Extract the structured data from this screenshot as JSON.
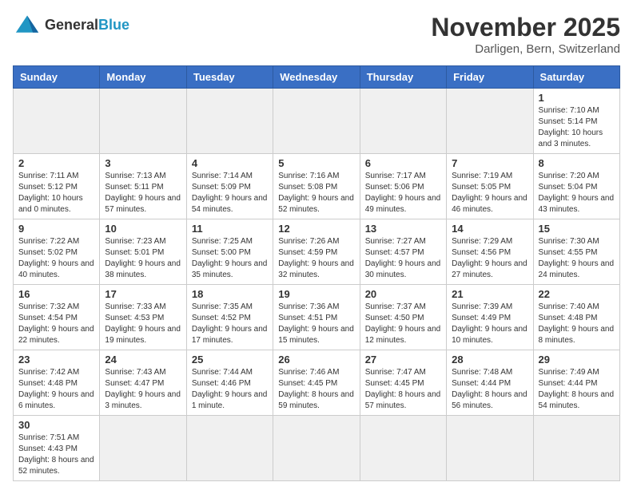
{
  "header": {
    "logo_general": "General",
    "logo_blue": "Blue",
    "month_year": "November 2025",
    "location": "Darligen, Bern, Switzerland"
  },
  "days_of_week": [
    "Sunday",
    "Monday",
    "Tuesday",
    "Wednesday",
    "Thursday",
    "Friday",
    "Saturday"
  ],
  "weeks": [
    [
      {
        "day": "",
        "info": "",
        "empty": true
      },
      {
        "day": "",
        "info": "",
        "empty": true
      },
      {
        "day": "",
        "info": "",
        "empty": true
      },
      {
        "day": "",
        "info": "",
        "empty": true
      },
      {
        "day": "",
        "info": "",
        "empty": true
      },
      {
        "day": "",
        "info": "",
        "empty": true
      },
      {
        "day": "1",
        "info": "Sunrise: 7:10 AM\nSunset: 5:14 PM\nDaylight: 10 hours and 3 minutes."
      }
    ],
    [
      {
        "day": "2",
        "info": "Sunrise: 7:11 AM\nSunset: 5:12 PM\nDaylight: 10 hours and 0 minutes."
      },
      {
        "day": "3",
        "info": "Sunrise: 7:13 AM\nSunset: 5:11 PM\nDaylight: 9 hours and 57 minutes."
      },
      {
        "day": "4",
        "info": "Sunrise: 7:14 AM\nSunset: 5:09 PM\nDaylight: 9 hours and 54 minutes."
      },
      {
        "day": "5",
        "info": "Sunrise: 7:16 AM\nSunset: 5:08 PM\nDaylight: 9 hours and 52 minutes."
      },
      {
        "day": "6",
        "info": "Sunrise: 7:17 AM\nSunset: 5:06 PM\nDaylight: 9 hours and 49 minutes."
      },
      {
        "day": "7",
        "info": "Sunrise: 7:19 AM\nSunset: 5:05 PM\nDaylight: 9 hours and 46 minutes."
      },
      {
        "day": "8",
        "info": "Sunrise: 7:20 AM\nSunset: 5:04 PM\nDaylight: 9 hours and 43 minutes."
      }
    ],
    [
      {
        "day": "9",
        "info": "Sunrise: 7:22 AM\nSunset: 5:02 PM\nDaylight: 9 hours and 40 minutes."
      },
      {
        "day": "10",
        "info": "Sunrise: 7:23 AM\nSunset: 5:01 PM\nDaylight: 9 hours and 38 minutes."
      },
      {
        "day": "11",
        "info": "Sunrise: 7:25 AM\nSunset: 5:00 PM\nDaylight: 9 hours and 35 minutes."
      },
      {
        "day": "12",
        "info": "Sunrise: 7:26 AM\nSunset: 4:59 PM\nDaylight: 9 hours and 32 minutes."
      },
      {
        "day": "13",
        "info": "Sunrise: 7:27 AM\nSunset: 4:57 PM\nDaylight: 9 hours and 30 minutes."
      },
      {
        "day": "14",
        "info": "Sunrise: 7:29 AM\nSunset: 4:56 PM\nDaylight: 9 hours and 27 minutes."
      },
      {
        "day": "15",
        "info": "Sunrise: 7:30 AM\nSunset: 4:55 PM\nDaylight: 9 hours and 24 minutes."
      }
    ],
    [
      {
        "day": "16",
        "info": "Sunrise: 7:32 AM\nSunset: 4:54 PM\nDaylight: 9 hours and 22 minutes."
      },
      {
        "day": "17",
        "info": "Sunrise: 7:33 AM\nSunset: 4:53 PM\nDaylight: 9 hours and 19 minutes."
      },
      {
        "day": "18",
        "info": "Sunrise: 7:35 AM\nSunset: 4:52 PM\nDaylight: 9 hours and 17 minutes."
      },
      {
        "day": "19",
        "info": "Sunrise: 7:36 AM\nSunset: 4:51 PM\nDaylight: 9 hours and 15 minutes."
      },
      {
        "day": "20",
        "info": "Sunrise: 7:37 AM\nSunset: 4:50 PM\nDaylight: 9 hours and 12 minutes."
      },
      {
        "day": "21",
        "info": "Sunrise: 7:39 AM\nSunset: 4:49 PM\nDaylight: 9 hours and 10 minutes."
      },
      {
        "day": "22",
        "info": "Sunrise: 7:40 AM\nSunset: 4:48 PM\nDaylight: 9 hours and 8 minutes."
      }
    ],
    [
      {
        "day": "23",
        "info": "Sunrise: 7:42 AM\nSunset: 4:48 PM\nDaylight: 9 hours and 6 minutes."
      },
      {
        "day": "24",
        "info": "Sunrise: 7:43 AM\nSunset: 4:47 PM\nDaylight: 9 hours and 3 minutes."
      },
      {
        "day": "25",
        "info": "Sunrise: 7:44 AM\nSunset: 4:46 PM\nDaylight: 9 hours and 1 minute."
      },
      {
        "day": "26",
        "info": "Sunrise: 7:46 AM\nSunset: 4:45 PM\nDaylight: 8 hours and 59 minutes."
      },
      {
        "day": "27",
        "info": "Sunrise: 7:47 AM\nSunset: 4:45 PM\nDaylight: 8 hours and 57 minutes."
      },
      {
        "day": "28",
        "info": "Sunrise: 7:48 AM\nSunset: 4:44 PM\nDaylight: 8 hours and 56 minutes."
      },
      {
        "day": "29",
        "info": "Sunrise: 7:49 AM\nSunset: 4:44 PM\nDaylight: 8 hours and 54 minutes."
      }
    ],
    [
      {
        "day": "30",
        "info": "Sunrise: 7:51 AM\nSunset: 4:43 PM\nDaylight: 8 hours and 52 minutes."
      },
      {
        "day": "",
        "info": "",
        "empty": true
      },
      {
        "day": "",
        "info": "",
        "empty": true
      },
      {
        "day": "",
        "info": "",
        "empty": true
      },
      {
        "day": "",
        "info": "",
        "empty": true
      },
      {
        "day": "",
        "info": "",
        "empty": true
      },
      {
        "day": "",
        "info": "",
        "empty": true
      }
    ]
  ]
}
